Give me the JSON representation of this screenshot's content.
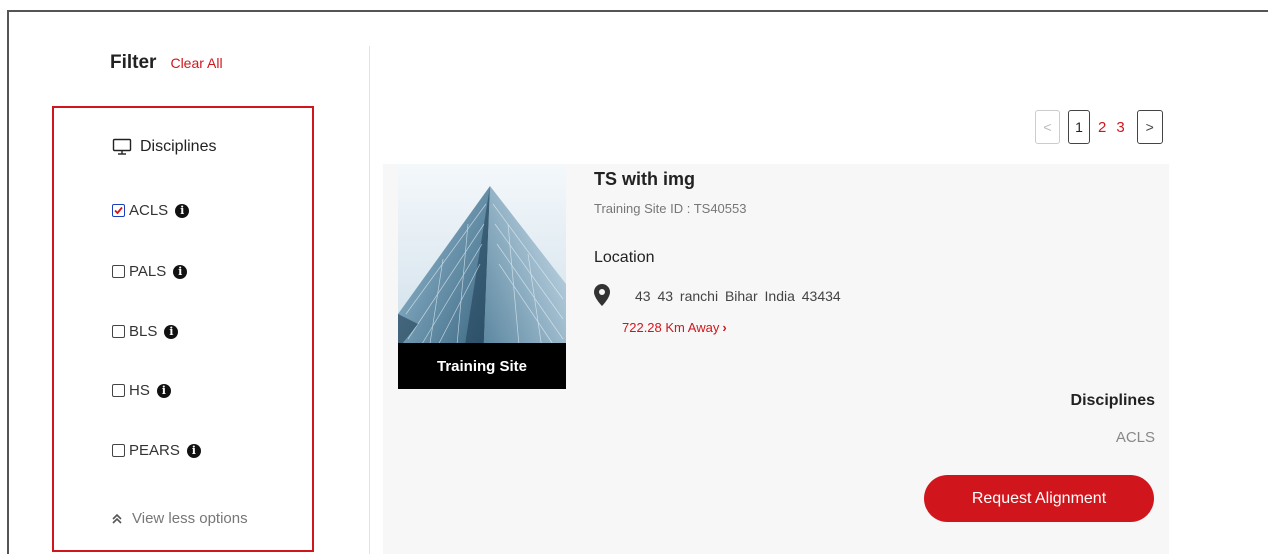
{
  "filter": {
    "title": "Filter",
    "clear_all": "Clear All",
    "section_title": "Disciplines",
    "section_icon": "monitor-icon",
    "options": [
      {
        "label": "ACLS",
        "checked": true
      },
      {
        "label": "PALS",
        "checked": false
      },
      {
        "label": "BLS",
        "checked": false
      },
      {
        "label": "HS",
        "checked": false
      },
      {
        "label": "PEARS",
        "checked": false
      }
    ],
    "view_less": "View less options"
  },
  "pagination": {
    "prev": "<",
    "current": "1",
    "pages": [
      "2",
      "3"
    ],
    "next": ">"
  },
  "result": {
    "image_caption": "Training Site",
    "name": "TS with img",
    "site_id": "Training Site ID : TS40553",
    "location_label": "Location",
    "address": "43 43 ranchi Bihar India 43434",
    "distance": "722.28 Km Away",
    "distance_arrow": "›",
    "disciplines_label": "Disciplines",
    "disciplines_value": "ACLS",
    "request_button": "Request Alignment"
  },
  "colors": {
    "accent": "#d0161c",
    "checkbox_checked": "#1a3fbf",
    "card_bg": "#f7f7f7"
  }
}
